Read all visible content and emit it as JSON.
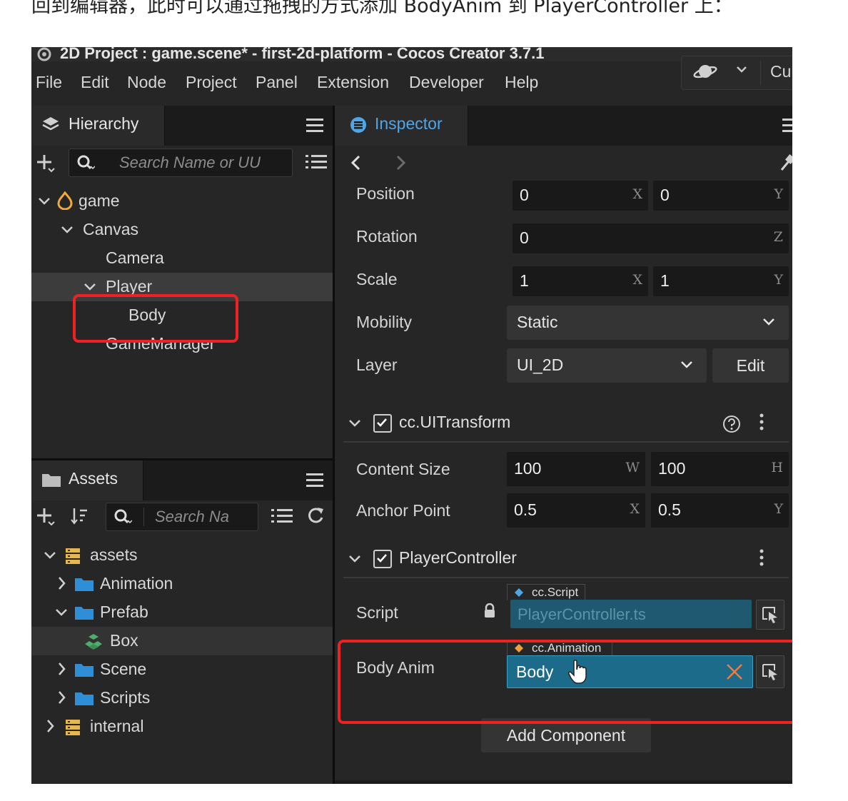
{
  "caption": "回到编辑器，此时可以通过拖拽的方式添加 BodyAnim 到 PlayerController 上：",
  "window": {
    "title": "2D Project : game.scene* - first-2d-platform - Cocos Creator 3.7.1",
    "menu": [
      "File",
      "Edit",
      "Node",
      "Project",
      "Panel",
      "Extension",
      "Developer",
      "Help"
    ],
    "top_right_label": "Cu"
  },
  "hierarchy": {
    "tab_label": "Hierarchy",
    "search_placeholder": "Search Name or UU",
    "nodes": [
      "game",
      "Canvas",
      "Camera",
      "Player",
      "Body",
      "GameManager"
    ]
  },
  "assets": {
    "tab_label": "Assets",
    "search_placeholder": "Search Na",
    "nodes": [
      "assets",
      "Animation",
      "Prefab",
      "Box",
      "Scene",
      "Scripts",
      "internal"
    ]
  },
  "inspector": {
    "tab_label": "Inspector",
    "position": {
      "label": "Position",
      "x": "0",
      "y": "0"
    },
    "rotation": {
      "label": "Rotation",
      "z": "0"
    },
    "scale": {
      "label": "Scale",
      "x": "1",
      "y": "1"
    },
    "mobility": {
      "label": "Mobility",
      "value": "Static"
    },
    "layer": {
      "label": "Layer",
      "value": "UI_2D",
      "edit": "Edit"
    },
    "axis": {
      "x": "X",
      "y": "Y",
      "z": "Z",
      "w": "W",
      "h": "H"
    },
    "uitransform": {
      "name": "cc.UITransform",
      "content_size": {
        "label": "Content Size",
        "w": "100",
        "h": "100"
      },
      "anchor_point": {
        "label": "Anchor Point",
        "x": "0.5",
        "y": "0.5"
      }
    },
    "player_controller": {
      "name": "PlayerController",
      "script": {
        "label": "Script",
        "type": "cc.Script",
        "value": "PlayerController.ts"
      },
      "body_anim": {
        "label": "Body Anim",
        "type": "cc.Animation",
        "value": "Body"
      }
    },
    "add_component": "Add Component"
  },
  "colors": {
    "highlight": "#ee2222",
    "object_field": "#1d6b8a",
    "accent": "#4ea6ea"
  }
}
